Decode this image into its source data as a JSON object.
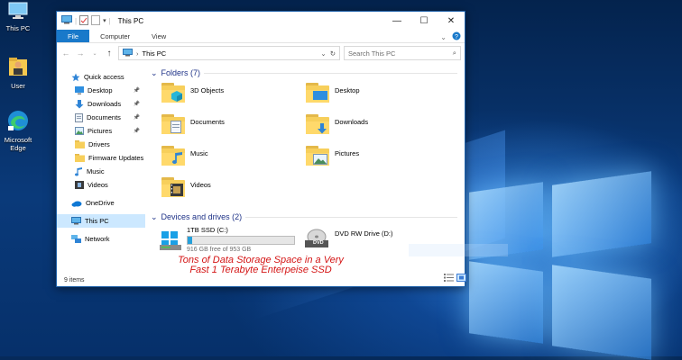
{
  "desktop": {
    "icons": [
      {
        "label": "This PC",
        "icon": "this-pc-icon"
      },
      {
        "label": "User",
        "icon": "user-folder-icon"
      },
      {
        "label": "Microsoft Edge",
        "icon": "edge-icon"
      }
    ]
  },
  "window": {
    "title": "This PC",
    "controls": {
      "minimize": "—",
      "maximize": "☐",
      "close": "✕"
    },
    "ribbon_tabs": [
      "File",
      "Computer",
      "View"
    ],
    "address": "This PC",
    "search_placeholder": "Search This PC",
    "sidebar": [
      {
        "label": "Quick access",
        "icon": "star-icon",
        "pinned": false,
        "sub": false
      },
      {
        "label": "Desktop",
        "icon": "desktop-icon",
        "pinned": true,
        "sub": true
      },
      {
        "label": "Downloads",
        "icon": "downloads-icon",
        "pinned": true,
        "sub": true
      },
      {
        "label": "Documents",
        "icon": "documents-icon",
        "pinned": true,
        "sub": true
      },
      {
        "label": "Pictures",
        "icon": "pictures-icon",
        "pinned": true,
        "sub": true
      },
      {
        "label": "Drivers",
        "icon": "folder-icon",
        "pinned": false,
        "sub": true
      },
      {
        "label": "Firmware Updates",
        "icon": "folder-icon",
        "pinned": false,
        "sub": true
      },
      {
        "label": "Music",
        "icon": "music-icon",
        "pinned": false,
        "sub": true
      },
      {
        "label": "Videos",
        "icon": "videos-icon",
        "pinned": false,
        "sub": true
      },
      {
        "label": "OneDrive",
        "icon": "onedrive-icon",
        "pinned": false,
        "sub": false
      },
      {
        "label": "This PC",
        "icon": "this-pc-icon",
        "pinned": false,
        "sub": false,
        "selected": true
      },
      {
        "label": "Network",
        "icon": "network-icon",
        "pinned": false,
        "sub": false
      }
    ],
    "folders_header": "Folders (7)",
    "folders": [
      {
        "label": "3D Objects",
        "icon": "3d-objects-icon"
      },
      {
        "label": "Desktop",
        "icon": "desktop-folder-icon"
      },
      {
        "label": "Documents",
        "icon": "documents-folder-icon"
      },
      {
        "label": "Downloads",
        "icon": "downloads-folder-icon"
      },
      {
        "label": "Music",
        "icon": "music-folder-icon"
      },
      {
        "label": "Pictures",
        "icon": "pictures-folder-icon"
      },
      {
        "label": "Videos",
        "icon": "videos-folder-icon"
      }
    ],
    "drives_header": "Devices and drives (2)",
    "drives": [
      {
        "label": "1TB SSD (C:)",
        "free_text": "916 GB free of 953 GB",
        "used_fraction": 0.04,
        "icon": "ssd-drive-icon"
      },
      {
        "label": "DVD RW Drive (D:)",
        "icon": "dvd-drive-icon",
        "badge": "DVD"
      }
    ],
    "status": "9 items",
    "caption_line1": "Tons of Data Storage Space in a Very",
    "caption_line2": "Fast 1 Terabyte Enterpeise SSD",
    "colors": {
      "accent": "#1979ca",
      "selection": "#cce8ff",
      "caption": "#d41414",
      "group_header": "#1e3287"
    }
  }
}
